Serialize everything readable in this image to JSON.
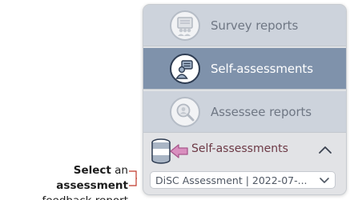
{
  "menu": {
    "items": [
      {
        "label": "Survey reports",
        "icon": "survey-reports-icon"
      },
      {
        "label": "Self-assessments",
        "icon": "self-assessment-icon",
        "active": true
      },
      {
        "label": "Assessee reports",
        "icon": "assessee-search-icon"
      }
    ]
  },
  "section": {
    "title": "Self-assessments",
    "icon": "database-arrow-icon",
    "toggle_icon": "chevron-up-icon"
  },
  "select": {
    "value": "DiSC Assessment | 2022-07-...",
    "icon": "chevron-down-icon"
  },
  "callout": {
    "word1": "Select",
    "word2": "an",
    "word3": "assessment",
    "line2": "feedback report"
  },
  "colors": {
    "active_bg": "#7f92ab",
    "inactive_bg": "#cdd3dc",
    "section_title": "#6d3a46",
    "accent_arrow": "#d98fbf"
  }
}
